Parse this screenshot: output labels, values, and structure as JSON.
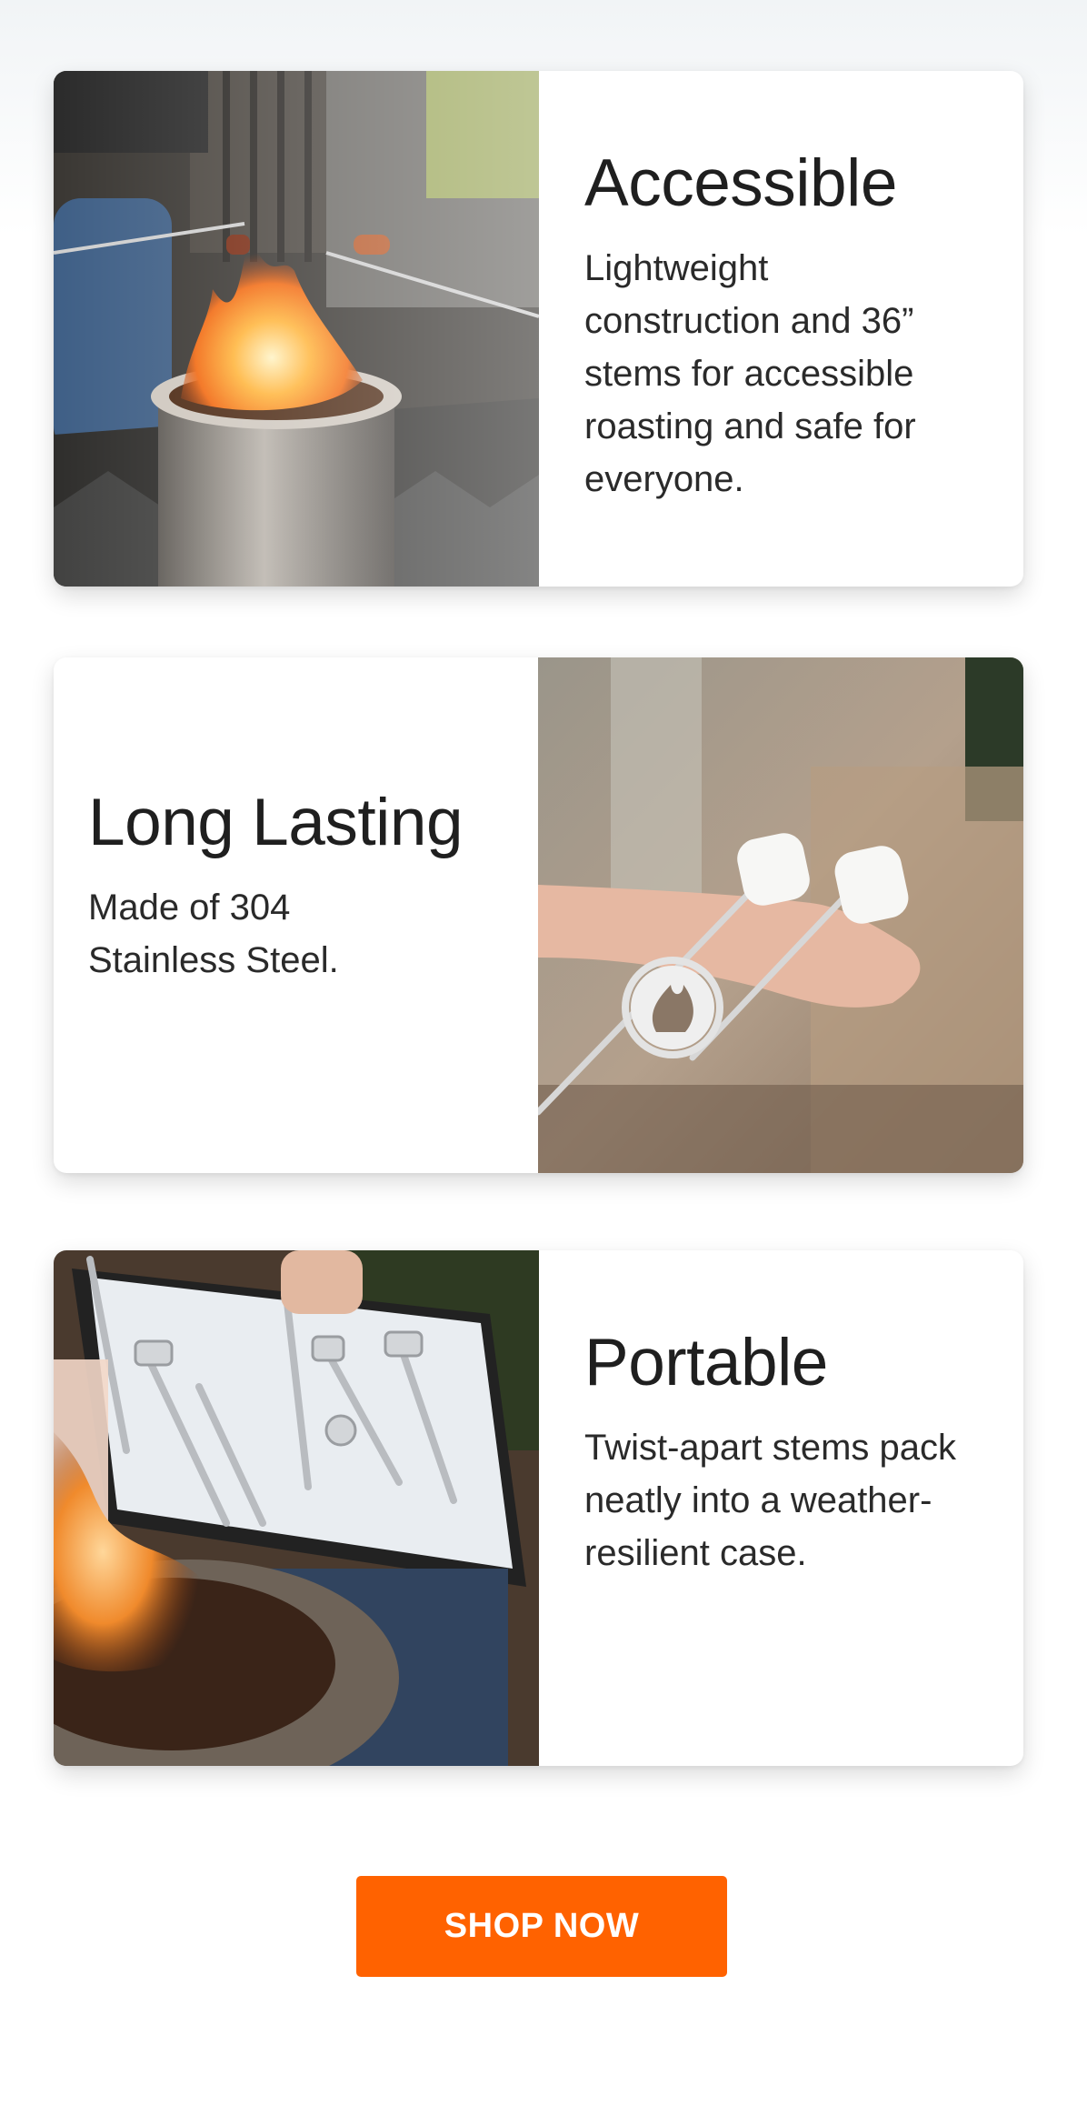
{
  "features": [
    {
      "title": "Accessible",
      "description": "Lightweight construction and 36” stems for accessible roasting and safe for everyone.",
      "image": "photo-fire-pit-roasting"
    },
    {
      "title": "Long Lasting",
      "description": "Made of 304 Stainless Steel.",
      "image": "photo-hand-holding-marshmallow-sticks"
    },
    {
      "title": "Portable",
      "description": "Twist-apart stems pack neatly into a weather-resilient case.",
      "image": "photo-roasting-sticks-in-case"
    }
  ],
  "cta": {
    "label": "SHOP NOW",
    "color": "#ff6200"
  }
}
